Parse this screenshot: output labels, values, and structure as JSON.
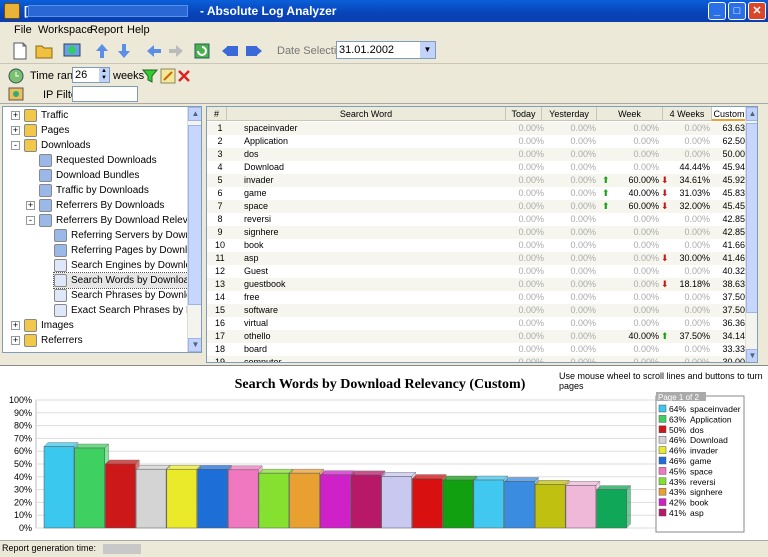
{
  "window": {
    "title": "[",
    "title_suffix": "- Absolute Log Analyzer",
    "min": "_",
    "max": "□",
    "close": "✕"
  },
  "menu": [
    "File",
    "Workspace",
    "Report",
    "Help"
  ],
  "toolbar": {
    "date_label": "Date Selection:",
    "date_value": "31.01.2002"
  },
  "filters": {
    "time_range_label": "Time range:",
    "time_range_value": "26",
    "time_unit": "weeks",
    "ip_filter_label": "IP Filter:",
    "ip_filter_value": ""
  },
  "tree": [
    {
      "label": "Traffic",
      "level": 0,
      "exp": "+",
      "icon": "folder-icon"
    },
    {
      "label": "Pages",
      "level": 0,
      "exp": "+",
      "icon": "folder-icon"
    },
    {
      "label": "Downloads",
      "level": 0,
      "exp": "-",
      "icon": "folder-open-icon"
    },
    {
      "label": "Requested Downloads",
      "level": 1,
      "exp": "",
      "icon": "report-icon"
    },
    {
      "label": "Download Bundles",
      "level": 1,
      "exp": "",
      "icon": "report-icon"
    },
    {
      "label": "Traffic by Downloads",
      "level": 1,
      "exp": "",
      "icon": "report-icon"
    },
    {
      "label": "Referrers By Downloads",
      "level": 1,
      "exp": "+",
      "icon": "report-icon"
    },
    {
      "label": "Referrers By Download Relevancy",
      "level": 1,
      "exp": "-",
      "icon": "report-icon"
    },
    {
      "label": "Referring Servers by Download",
      "level": 2,
      "exp": "",
      "icon": "report-icon"
    },
    {
      "label": "Referring Pages by Download R",
      "level": 2,
      "exp": "",
      "icon": "report-icon"
    },
    {
      "label": "Search Engines by Download Re",
      "level": 2,
      "exp": "",
      "icon": "search-icon"
    },
    {
      "label": "Search Words by Download Rele",
      "level": 2,
      "exp": "",
      "icon": "search-icon",
      "selected": true
    },
    {
      "label": "Search Phrases by Download Re",
      "level": 2,
      "exp": "",
      "icon": "search-icon"
    },
    {
      "label": "Exact Search Phrases by Downl",
      "level": 2,
      "exp": "",
      "icon": "search-icon"
    },
    {
      "label": "Images",
      "level": 0,
      "exp": "+",
      "icon": "folder-icon"
    },
    {
      "label": "Referrers",
      "level": 0,
      "exp": "+",
      "icon": "folder-icon"
    }
  ],
  "table": {
    "headers": [
      "#",
      "Search Word",
      "Today",
      "Yesterday",
      "Week",
      "4 Weeks",
      "Custom"
    ],
    "rows": [
      {
        "n": "1",
        "w": "spaceinvader",
        "td": "0.00%",
        "yd": "0.00%",
        "wk": "0.00%",
        "wa": "",
        "fw": "0.00%",
        "fa": "",
        "cu": "63.63%"
      },
      {
        "n": "2",
        "w": "Application",
        "td": "0.00%",
        "yd": "0.00%",
        "wk": "0.00%",
        "wa": "",
        "fw": "0.00%",
        "fa": "",
        "cu": "62.50%"
      },
      {
        "n": "3",
        "w": "dos",
        "td": "0.00%",
        "yd": "0.00%",
        "wk": "0.00%",
        "wa": "",
        "fw": "0.00%",
        "fa": "",
        "cu": "50.00%"
      },
      {
        "n": "4",
        "w": "Download",
        "td": "0.00%",
        "yd": "0.00%",
        "wk": "0.00%",
        "wa": "",
        "fw": "44.44%",
        "fa": "",
        "cu": "45.94%"
      },
      {
        "n": "5",
        "w": "invader",
        "td": "0.00%",
        "yd": "0.00%",
        "wk": "60.00%",
        "wa": "up",
        "fw": "34.61%",
        "fa": "down",
        "cu": "45.92%"
      },
      {
        "n": "6",
        "w": "game",
        "td": "0.00%",
        "yd": "0.00%",
        "wk": "40.00%",
        "wa": "up",
        "fw": "31.03%",
        "fa": "down",
        "cu": "45.83%"
      },
      {
        "n": "7",
        "w": "space",
        "td": "0.00%",
        "yd": "0.00%",
        "wk": "60.00%",
        "wa": "up",
        "fw": "32.00%",
        "fa": "down",
        "cu": "45.45%"
      },
      {
        "n": "8",
        "w": "reversi",
        "td": "0.00%",
        "yd": "0.00%",
        "wk": "0.00%",
        "wa": "",
        "fw": "0.00%",
        "fa": "",
        "cu": "42.85%"
      },
      {
        "n": "9",
        "w": "signhere",
        "td": "0.00%",
        "yd": "0.00%",
        "wk": "0.00%",
        "wa": "",
        "fw": "0.00%",
        "fa": "",
        "cu": "42.85%"
      },
      {
        "n": "10",
        "w": "book",
        "td": "0.00%",
        "yd": "0.00%",
        "wk": "0.00%",
        "wa": "",
        "fw": "0.00%",
        "fa": "",
        "cu": "41.66%"
      },
      {
        "n": "11",
        "w": "asp",
        "td": "0.00%",
        "yd": "0.00%",
        "wk": "0.00%",
        "wa": "",
        "fw": "30.00%",
        "fa": "down",
        "cu": "41.46%"
      },
      {
        "n": "12",
        "w": "Guest",
        "td": "0.00%",
        "yd": "0.00%",
        "wk": "0.00%",
        "wa": "",
        "fw": "0.00%",
        "fa": "",
        "cu": "40.32%"
      },
      {
        "n": "13",
        "w": "guestbook",
        "td": "0.00%",
        "yd": "0.00%",
        "wk": "0.00%",
        "wa": "",
        "fw": "18.18%",
        "fa": "down",
        "cu": "38.63%"
      },
      {
        "n": "14",
        "w": "free",
        "td": "0.00%",
        "yd": "0.00%",
        "wk": "0.00%",
        "wa": "",
        "fw": "0.00%",
        "fa": "",
        "cu": "37.50%"
      },
      {
        "n": "15",
        "w": "software",
        "td": "0.00%",
        "yd": "0.00%",
        "wk": "0.00%",
        "wa": "",
        "fw": "0.00%",
        "fa": "",
        "cu": "37.50%"
      },
      {
        "n": "16",
        "w": "virtual",
        "td": "0.00%",
        "yd": "0.00%",
        "wk": "0.00%",
        "wa": "",
        "fw": "0.00%",
        "fa": "",
        "cu": "36.36%"
      },
      {
        "n": "17",
        "w": "othello",
        "td": "0.00%",
        "yd": "0.00%",
        "wk": "40.00%",
        "wa": "",
        "fw": "37.50%",
        "fa": "up",
        "cu": "34.14%"
      },
      {
        "n": "18",
        "w": "board",
        "td": "0.00%",
        "yd": "0.00%",
        "wk": "0.00%",
        "wa": "",
        "fw": "0.00%",
        "fa": "",
        "cu": "33.33%"
      },
      {
        "n": "19",
        "w": "computer",
        "td": "0.00%",
        "yd": "0.00%",
        "wk": "0.00%",
        "wa": "",
        "fw": "0.00%",
        "fa": "",
        "cu": "30.00%"
      }
    ]
  },
  "chart_hint": "Use mouse wheel to scroll lines and buttons to turn pages",
  "chart_data": {
    "type": "bar",
    "title": "Search Words by Download Relevancy (Custom)",
    "ylim": [
      0,
      100
    ],
    "yticks": [
      "0%",
      "10%",
      "20%",
      "30%",
      "40%",
      "50%",
      "60%",
      "70%",
      "80%",
      "90%",
      "100%"
    ],
    "values": [
      63.63,
      62.5,
      50,
      45.94,
      45.92,
      45.83,
      45.45,
      42.85,
      42.85,
      41.66,
      41.46,
      40.32,
      38.63,
      37.5,
      37.5,
      36.36,
      34.14,
      33.33,
      30.0
    ],
    "colors": [
      "#3ac8ee",
      "#3ed060",
      "#cc1818",
      "#d4d4d4",
      "#eaea2a",
      "#1e6ed8",
      "#f078c0",
      "#86e030",
      "#e8a030",
      "#d020c8",
      "#b81868",
      "#c8c8f0",
      "#d81010",
      "#10a010",
      "#40c8f0",
      "#3a8ce0",
      "#c0c010",
      "#f0b8d8",
      "#10a858",
      "#d8185a"
    ],
    "legend_page": "Page 1 of 2",
    "legend": [
      {
        "pct": "64%",
        "name": "spaceinvader",
        "color": "#3ac8ee"
      },
      {
        "pct": "63%",
        "name": "Application",
        "color": "#3ed060"
      },
      {
        "pct": "50%",
        "name": "dos",
        "color": "#cc1818"
      },
      {
        "pct": "46%",
        "name": "Download",
        "color": "#d4d4d4"
      },
      {
        "pct": "46%",
        "name": "invader",
        "color": "#eaea2a"
      },
      {
        "pct": "46%",
        "name": "game",
        "color": "#1e6ed8"
      },
      {
        "pct": "45%",
        "name": "space",
        "color": "#f078c0"
      },
      {
        "pct": "43%",
        "name": "reversi",
        "color": "#86e030"
      },
      {
        "pct": "43%",
        "name": "signhere",
        "color": "#e8a030"
      },
      {
        "pct": "42%",
        "name": "book",
        "color": "#d020c8"
      },
      {
        "pct": "41%",
        "name": "asp",
        "color": "#b81868"
      }
    ]
  },
  "status": {
    "label": "Report generation time:"
  }
}
